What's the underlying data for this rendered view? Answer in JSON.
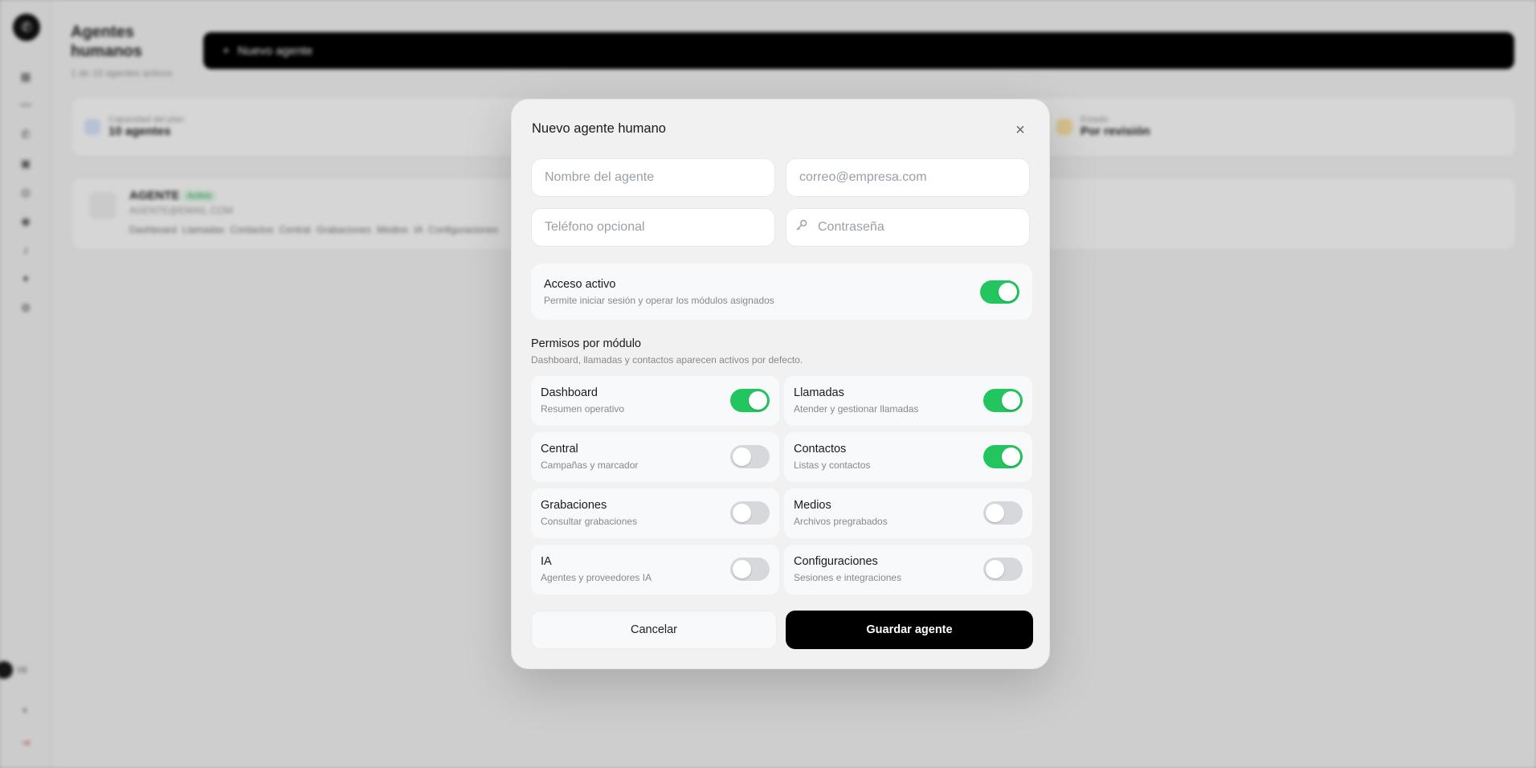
{
  "background": {
    "page_title": "Agentes humanos",
    "page_subtitle": "1 de 10 agentes activos",
    "new_agent_label": "Nuevo agente",
    "stats": [
      {
        "label": "Capacidad del plan",
        "value": "10 agentes"
      },
      {
        "label": "Estado",
        "value": "Por revisión"
      }
    ],
    "agent_card": {
      "name": "AGENTE",
      "badge": "Activo",
      "email": "AGENTE@EMAIL.COM",
      "modules": "Dashboard Llamadas Contactos Central Grabaciones Medios IA Configuraciones"
    },
    "user_initials": "Hi"
  },
  "modal": {
    "title": "Nuevo agente humano",
    "fields": {
      "name_placeholder": "Nombre del agente",
      "email_placeholder": "correo@empresa.com",
      "phone_placeholder": "Teléfono opcional",
      "password_placeholder": "Contraseña"
    },
    "access": {
      "title": "Acceso activo",
      "description": "Permite iniciar sesión y operar los módulos asignados",
      "enabled": true
    },
    "permissions": {
      "title": "Permisos por módulo",
      "description": "Dashboard, llamadas y contactos aparecen activos por defecto.",
      "modules": [
        {
          "title": "Dashboard",
          "description": "Resumen operativo",
          "enabled": true
        },
        {
          "title": "Llamadas",
          "description": "Atender y gestionar llamadas",
          "enabled": true
        },
        {
          "title": "Central",
          "description": "Campañas y marcador",
          "enabled": false
        },
        {
          "title": "Contactos",
          "description": "Listas y contactos",
          "enabled": true
        },
        {
          "title": "Grabaciones",
          "description": "Consultar grabaciones",
          "enabled": false
        },
        {
          "title": "Medios",
          "description": "Archivos pregrabados",
          "enabled": false
        },
        {
          "title": "IA",
          "description": "Agentes y proveedores IA",
          "enabled": false
        },
        {
          "title": "Configuraciones",
          "description": "Sesiones e integraciones",
          "enabled": false
        }
      ]
    },
    "cancel_label": "Cancelar",
    "save_label": "Guardar agente"
  },
  "colors": {
    "toggle_on": "#22c55e",
    "toggle_off": "#d6d8dc",
    "primary_button": "#000000"
  }
}
